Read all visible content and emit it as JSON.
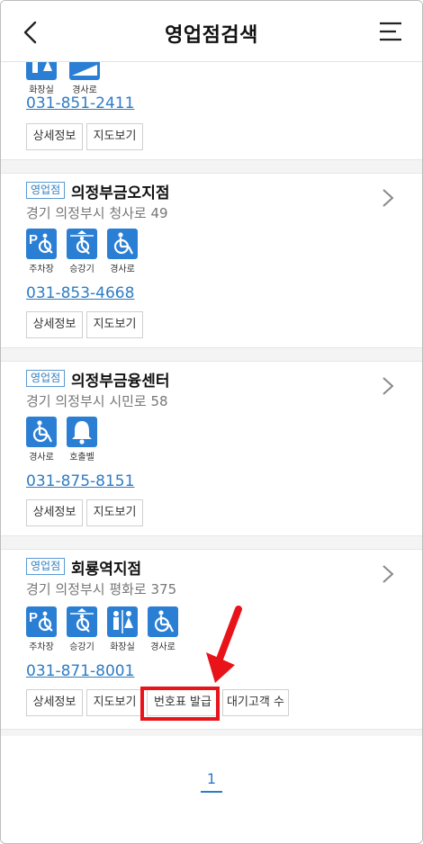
{
  "header": {
    "title": "영업점검색"
  },
  "items": [
    {
      "facilities": [
        "화장실",
        "경사로"
      ],
      "phone": "031-851-2411",
      "buttons": [
        "상세정보",
        "지도보기"
      ]
    },
    {
      "badge": "영업점",
      "name": "의정부금오지점",
      "address": "경기 의정부시 청사로 49",
      "facilities": [
        "주차장",
        "승강기",
        "경사로"
      ],
      "phone": "031-853-4668",
      "buttons": [
        "상세정보",
        "지도보기"
      ]
    },
    {
      "badge": "영업점",
      "name": "의정부금융센터",
      "address": "경기 의정부시 시민로 58",
      "facilities": [
        "경사로",
        "호출벨"
      ],
      "phone": "031-875-8151",
      "buttons": [
        "상세정보",
        "지도보기"
      ]
    },
    {
      "badge": "영업점",
      "name": "회룡역지점",
      "address": "경기 의정부시 평화로 375",
      "facilities": [
        "주차장",
        "승강기",
        "화장실",
        "경사로"
      ],
      "phone": "031-871-8001",
      "buttons": [
        "상세정보",
        "지도보기",
        "번호표 발급",
        "대기고객 수"
      ]
    }
  ],
  "pagination": {
    "current": "1"
  },
  "colors": {
    "accent": "#2e7cc4",
    "icon_bg": "#2a7fd4",
    "highlight": "#e8141a"
  }
}
